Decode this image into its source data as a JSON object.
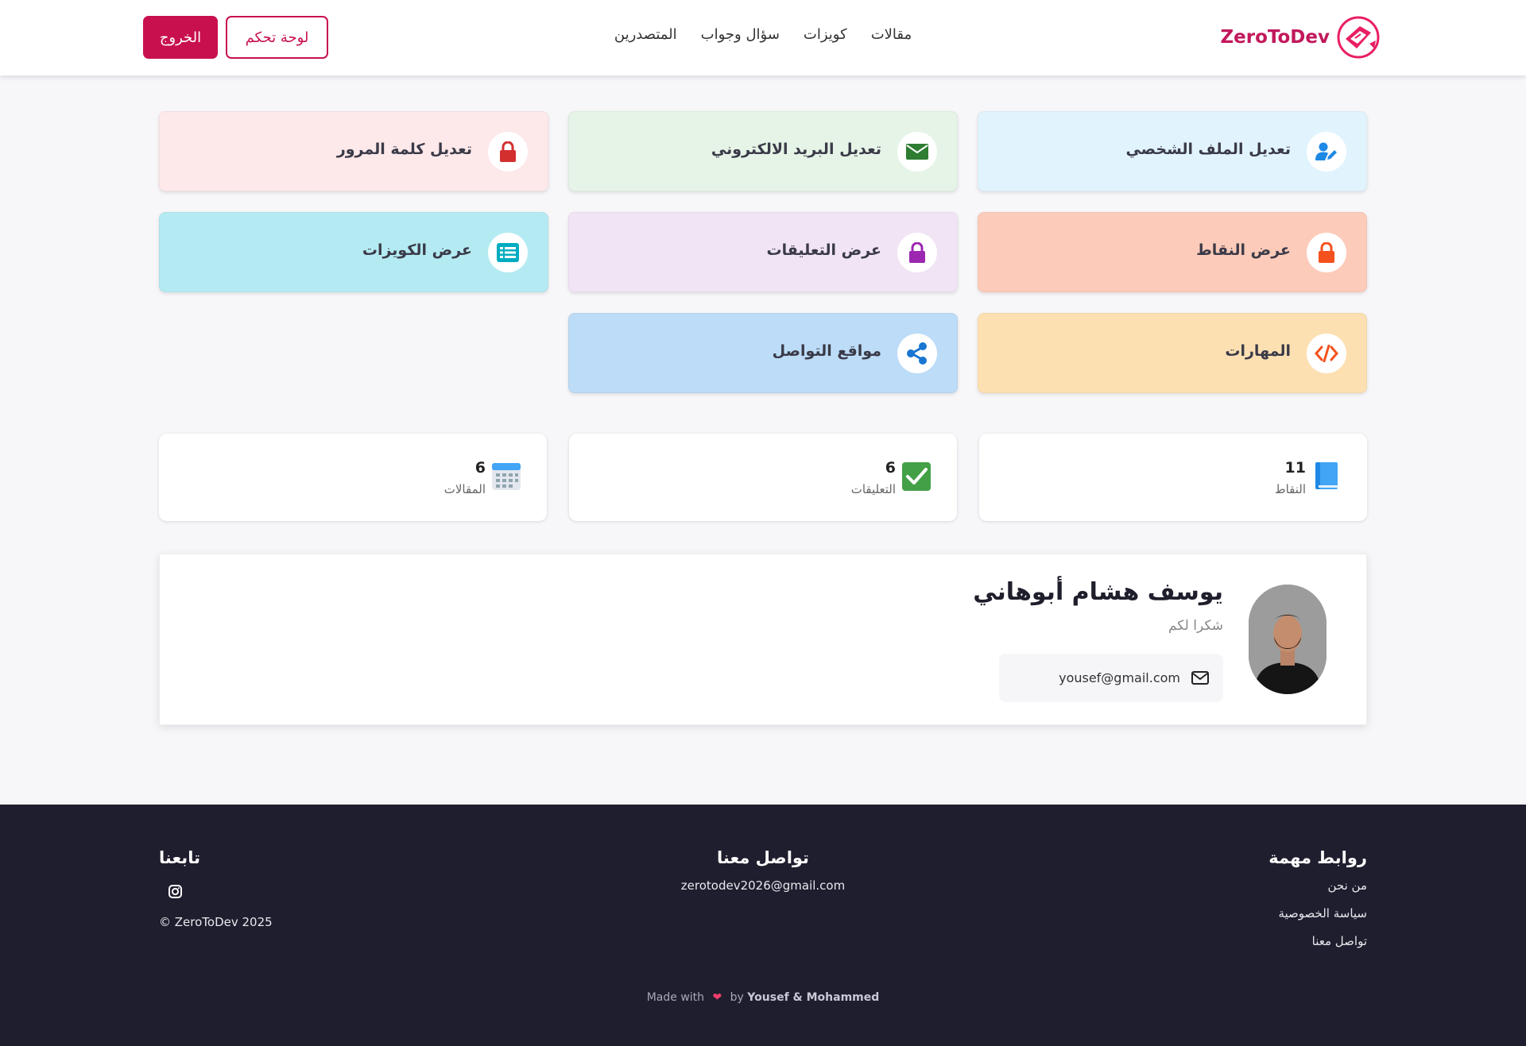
{
  "header": {
    "logo_text": "ZeroToDev",
    "nav": [
      "مقالات",
      "كويزات",
      "سؤال وجواب",
      "المتصدرين"
    ],
    "logout_label": "الخروج",
    "dashboard_label": "لوحة تحكم"
  },
  "cards": [
    {
      "label": "تعديل الملف الشخصي",
      "icon": "user-edit-icon",
      "color": "#e1f4fd"
    },
    {
      "label": "تعديل البريد الالكتروني",
      "icon": "envelope-icon",
      "color": "#e6f4e7"
    },
    {
      "label": "تعديل كلمة المرور",
      "icon": "lock-icon",
      "color": "#fde8ea"
    },
    {
      "label": "عرض النقاط",
      "icon": "lock-icon",
      "color": "#fdcbb9"
    },
    {
      "label": "عرض التعليقات",
      "icon": "lock-icon",
      "color": "#f1e4f4"
    },
    {
      "label": "عرض الكويزات",
      "icon": "list-icon",
      "color": "#b4ebf2"
    },
    {
      "label": "المهارات",
      "icon": "code-icon",
      "color": "#fde0b2"
    },
    {
      "label": "مواقع التواصل",
      "icon": "share-icon",
      "color": "#bcdcf7"
    }
  ],
  "stats": [
    {
      "value": "11",
      "label": "النقاط",
      "icon": "book-icon"
    },
    {
      "value": "6",
      "label": "التعليقات",
      "icon": "check-icon"
    },
    {
      "value": "6",
      "label": "المقالات",
      "icon": "calendar-icon"
    }
  ],
  "profile": {
    "name": "يوسف هشام أبوهاني",
    "subtitle": "شكرا لكم",
    "email": "yousef@gmail.com"
  },
  "footer": {
    "links_title": "روابط مهمة",
    "links": [
      "من نحن",
      "سياسة الخصوصية",
      "تواصل معنا"
    ],
    "contact_title": "تواصل معنا",
    "contact_email": "zerotodev2026@gmail.com",
    "follow_title": "تابعنا",
    "copyright": "© ZeroToDev 2025",
    "made_with": "Made with",
    "made_by_prefix": "by",
    "made_by": "Yousef & Mohammed"
  }
}
